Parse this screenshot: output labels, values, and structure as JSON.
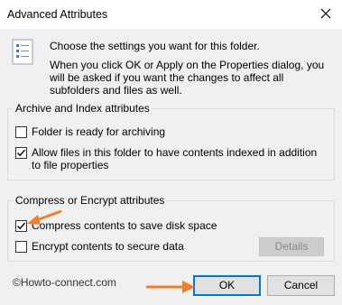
{
  "window": {
    "title": "Advanced Attributes",
    "close_icon": "close-icon"
  },
  "intro": {
    "line1": "Choose the settings you want for this folder.",
    "line2": "When you click OK or Apply on the Properties dialog, you will be asked if you want the changes to affect all subfolders and files as well."
  },
  "archive_group": {
    "legend": "Archive and Index attributes",
    "items": [
      {
        "label": "Folder is ready for archiving",
        "checked": false
      },
      {
        "label": "Allow files in this folder to have contents indexed in addition to file properties",
        "checked": true
      }
    ]
  },
  "compress_group": {
    "legend": "Compress or Encrypt attributes",
    "items": [
      {
        "label": "Compress contents to save disk space",
        "checked": true
      },
      {
        "label": "Encrypt contents to secure data",
        "checked": false
      }
    ],
    "details_label": "Details"
  },
  "buttons": {
    "ok_label": "OK",
    "cancel_label": "Cancel"
  },
  "watermark": "©Howto-connect.com",
  "colors": {
    "accent": "#0078d7",
    "arrow": "#f07f2d",
    "client_bg": "#f0f0f0"
  }
}
